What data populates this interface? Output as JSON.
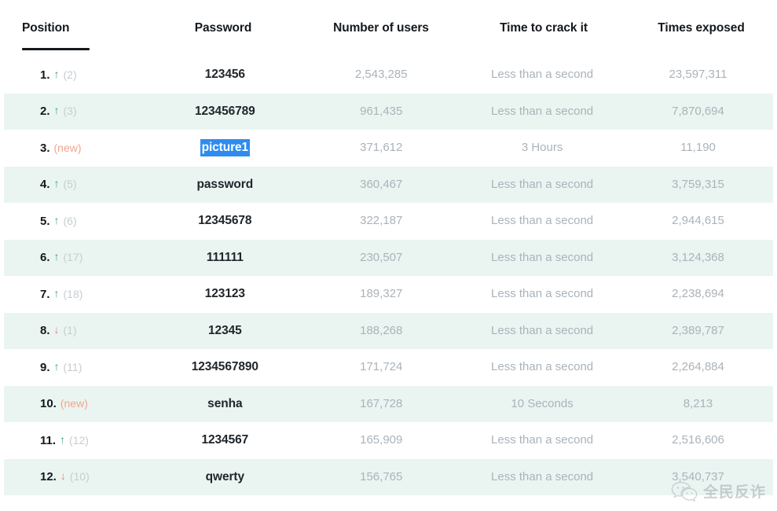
{
  "table": {
    "columns": [
      {
        "key": "position",
        "label": "Position"
      },
      {
        "key": "password",
        "label": "Password"
      },
      {
        "key": "users",
        "label": "Number of users"
      },
      {
        "key": "crack",
        "label": "Time to crack it"
      },
      {
        "key": "exposed",
        "label": "Times exposed"
      }
    ],
    "rows": [
      {
        "rank": "1.",
        "trend": "up",
        "trend_glyph": "↑",
        "previous": "(2)",
        "password": "123456",
        "selected": false,
        "users": "2,543,285",
        "crack": "Less than a second",
        "exposed": "23,597,311"
      },
      {
        "rank": "2.",
        "trend": "up",
        "trend_glyph": "↑",
        "previous": "(3)",
        "password": "123456789",
        "selected": false,
        "users": "961,435",
        "crack": "Less than a second",
        "exposed": "7,870,694"
      },
      {
        "rank": "3.",
        "trend": "new",
        "trend_glyph": "",
        "previous": "(new)",
        "password": "picture1",
        "selected": true,
        "users": "371,612",
        "crack": "3 Hours",
        "exposed": "11,190"
      },
      {
        "rank": "4.",
        "trend": "up",
        "trend_glyph": "↑",
        "previous": "(5)",
        "password": "password",
        "selected": false,
        "users": "360,467",
        "crack": "Less than a second",
        "exposed": "3,759,315"
      },
      {
        "rank": "5.",
        "trend": "up",
        "trend_glyph": "↑",
        "previous": "(6)",
        "password": "12345678",
        "selected": false,
        "users": "322,187",
        "crack": "Less than a second",
        "exposed": "2,944,615"
      },
      {
        "rank": "6.",
        "trend": "up",
        "trend_glyph": "↑",
        "previous": "(17)",
        "password": "111111",
        "selected": false,
        "users": "230,507",
        "crack": "Less than a second",
        "exposed": "3,124,368"
      },
      {
        "rank": "7.",
        "trend": "up",
        "trend_glyph": "↑",
        "previous": "(18)",
        "password": "123123",
        "selected": false,
        "users": "189,327",
        "crack": "Less than a second",
        "exposed": "2,238,694"
      },
      {
        "rank": "8.",
        "trend": "down",
        "trend_glyph": "↓",
        "previous": "(1)",
        "password": "12345",
        "selected": false,
        "users": "188,268",
        "crack": "Less than a second",
        "exposed": "2,389,787"
      },
      {
        "rank": "9.",
        "trend": "up",
        "trend_glyph": "↑",
        "previous": "(11)",
        "password": "1234567890",
        "selected": false,
        "users": "171,724",
        "crack": "Less than a second",
        "exposed": "2,264,884"
      },
      {
        "rank": "10.",
        "trend": "new",
        "trend_glyph": "",
        "previous": "(new)",
        "password": "senha",
        "selected": false,
        "users": "167,728",
        "crack": "10 Seconds",
        "exposed": "8,213"
      },
      {
        "rank": "11.",
        "trend": "up",
        "trend_glyph": "↑",
        "previous": "(12)",
        "password": "1234567",
        "selected": false,
        "users": "165,909",
        "crack": "Less than a second",
        "exposed": "2,516,606"
      },
      {
        "rank": "12.",
        "trend": "down",
        "trend_glyph": "↓",
        "previous": "(10)",
        "password": "qwerty",
        "selected": false,
        "users": "156,765",
        "crack": "Less than a second",
        "exposed": "3,540,737"
      }
    ]
  },
  "watermark": {
    "text": "全民反诈",
    "icon": "wechat-bubble-icon"
  },
  "colors": {
    "row_alt_bg": "#eaf5f1",
    "row_bg": "#ffffff",
    "header_text": "#14181c",
    "muted_text": "#aab3ba",
    "trend_up": "#3aa488",
    "trend_down": "#ef7b7b",
    "trend_new": "#f0a58c",
    "selection": "#2e8cf0"
  }
}
